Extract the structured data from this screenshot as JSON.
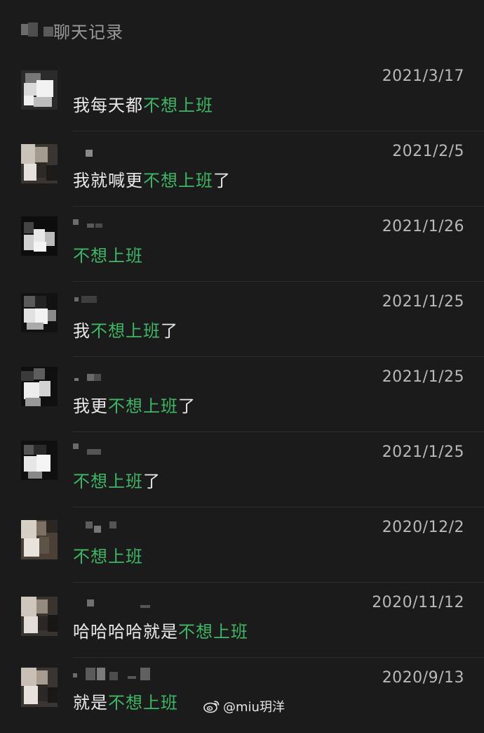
{
  "header": {
    "title": "聊天记录"
  },
  "messages": [
    {
      "date": "2021/3/17",
      "pre": "我每天都",
      "hl": "不想上班",
      "post": ""
    },
    {
      "date": "2021/2/5",
      "pre": "我就喊更",
      "hl": "不想上班",
      "post": "了"
    },
    {
      "date": "2021/1/26",
      "pre": "",
      "hl": "不想上班",
      "post": ""
    },
    {
      "date": "2021/1/25",
      "pre": " 我",
      "hl": "不想上班",
      "post": "了"
    },
    {
      "date": "2021/1/25",
      "pre": "我更",
      "hl": "不想上班",
      "post": "了"
    },
    {
      "date": "2021/1/25",
      "pre": "",
      "hl": "不想上班",
      "post": "了"
    },
    {
      "date": "2020/12/2",
      "pre": "",
      "hl": "不想上班",
      "post": ""
    },
    {
      "date": "2020/11/12",
      "pre": "哈哈哈哈就是",
      "hl": "不想上班",
      "post": ""
    },
    {
      "date": "2020/9/13",
      "pre": "就是",
      "hl": "不想上班",
      "post": ""
    }
  ],
  "watermark": {
    "text": "@miu玥洋",
    "icon": "weibo-icon"
  },
  "colors": {
    "background": "#1b1b1b",
    "highlight": "#3fb866",
    "text": "#e9e9e9",
    "date": "#b9b9b9"
  }
}
